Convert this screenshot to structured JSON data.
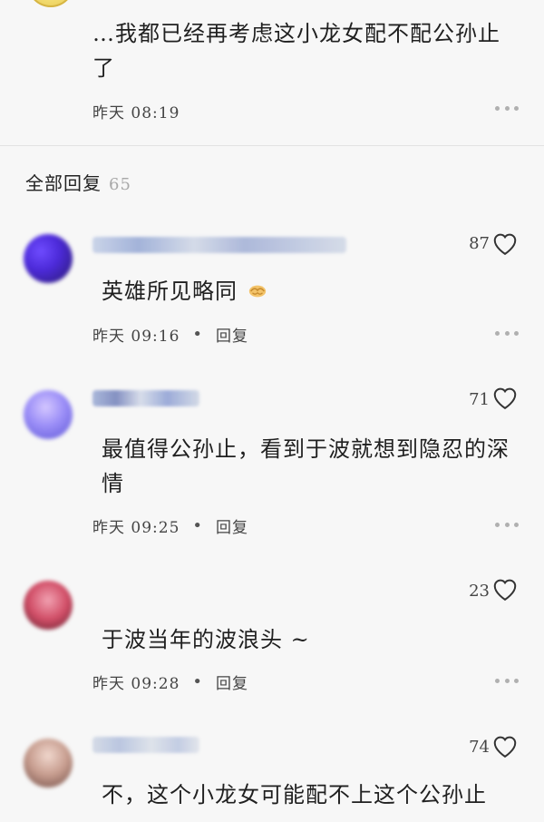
{
  "top_comment": {
    "text": "…我都已经再考虑这小龙女配不配公孙止了",
    "time": "昨天 08:19"
  },
  "section": {
    "title": "全部回复",
    "count": "65"
  },
  "comments": [
    {
      "text": "英雄所见略同",
      "emoji": "handshake-emoji",
      "time": "昨天 09:16",
      "reply_label": "回复",
      "likes": "87"
    },
    {
      "text": "最值得公孙止，看到于波就想到隐忍的深情",
      "time": "昨天 09:25",
      "reply_label": "回复",
      "likes": "71"
    },
    {
      "text": "于波当年的波浪头 ~",
      "time": "昨天 09:28",
      "reply_label": "回复",
      "likes": "23"
    },
    {
      "text": "不，这个小龙女可能配不上这个公孙止",
      "likes": "74"
    }
  ],
  "colors": {
    "background": "#f7f7f7",
    "text": "#202020",
    "meta": "#444444",
    "muted_count": "#a8a8a8",
    "divider": "#e2e2e2",
    "more_dots": "#b0b0b0"
  },
  "icons": {
    "like": "heart-outline-icon",
    "more": "more-dots-icon",
    "emoji": "handshake-emoji"
  }
}
